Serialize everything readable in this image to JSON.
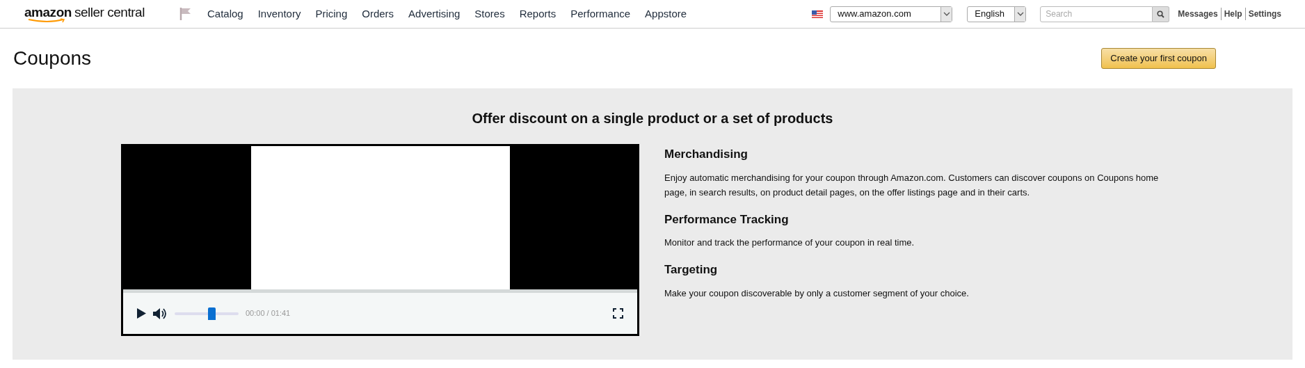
{
  "header": {
    "logo": {
      "word1": "amazon",
      "word2": "seller central"
    },
    "nav": [
      "Catalog",
      "Inventory",
      "Pricing",
      "Orders",
      "Advertising",
      "Stores",
      "Reports",
      "Performance",
      "Appstore"
    ],
    "marketplace": "www.amazon.com",
    "language": "English",
    "search": {
      "placeholder": "Search"
    },
    "links": [
      "Messages",
      "Help",
      "Settings"
    ]
  },
  "page": {
    "title": "Coupons",
    "create_button": "Create your first coupon"
  },
  "promo": {
    "heading": "Offer discount on a single product or a set of products",
    "video": {
      "playing": false,
      "volume": {
        "level": 0.58
      },
      "time": "00:00 / 01:41"
    },
    "features": [
      {
        "title": "Merchandising",
        "text": "Enjoy automatic merchandising for your coupon through Amazon.com. Customers can discover coupons on Coupons home page, in search results, on product detail pages, on the offer listings page and in their carts."
      },
      {
        "title": "Performance Tracking",
        "text": "Monitor and track the performance of your coupon in real time."
      },
      {
        "title": "Targeting",
        "text": "Make your coupon discoverable by only a customer segment of your choice."
      }
    ]
  }
}
